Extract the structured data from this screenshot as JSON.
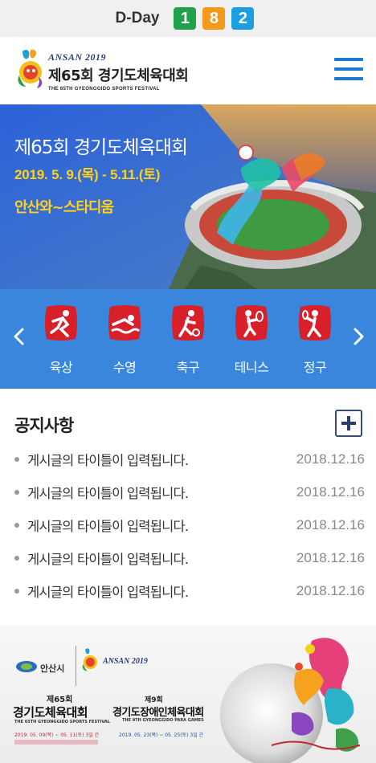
{
  "dday": {
    "label": "D-Day",
    "digits": [
      {
        "value": "1",
        "color": "#1fa34a"
      },
      {
        "value": "8",
        "color": "#f39a1a"
      },
      {
        "value": "2",
        "color": "#1a9fe0"
      }
    ]
  },
  "header": {
    "logo_ansan": "ANSAN 2019",
    "logo_main": "제65회 경기도체육대회",
    "logo_sub": "THE 65TH GYEONGGIDO SPORTS FESTIVAL"
  },
  "hero": {
    "title": "제65회 경기도체육대회",
    "date": "2019. 5. 9.(목) - 5.11.(토)",
    "venue": "안산와~스타디움"
  },
  "sports": {
    "items": [
      {
        "label": "육상",
        "icon": "athletics-icon"
      },
      {
        "label": "수영",
        "icon": "swimming-icon"
      },
      {
        "label": "축구",
        "icon": "soccer-icon"
      },
      {
        "label": "테니스",
        "icon": "tennis-icon"
      },
      {
        "label": "정구",
        "icon": "soft-tennis-icon"
      }
    ]
  },
  "notice": {
    "title": "공지사항",
    "rows": [
      {
        "title": "게시글의 타이틀이 입력됩니다.",
        "date": "2018.12.16"
      },
      {
        "title": "게시글의 타이틀이 입력됩니다.",
        "date": "2018.12.16"
      },
      {
        "title": "게시글의 타이틀이 입력됩니다.",
        "date": "2018.12.16"
      },
      {
        "title": "게시글의 타이틀이 입력됩니다.",
        "date": "2018.12.16"
      },
      {
        "title": "게시글의 타이틀이 입력됩니다.",
        "date": "2018.12.16"
      }
    ]
  },
  "banner": {
    "city": "안산시",
    "ansan": "ANSAN 2019",
    "left_edition": "제65회",
    "left_title": "경기도체육대회",
    "left_sub": "THE 65TH GYEONGGIDO SPORTS FESTIVAL",
    "left_date": "2019. 05. 09(목) ~ 05. 11(토) 3일 간",
    "right_edition": "제9회",
    "right_title": "경기도장애인체육대회",
    "right_sub": "THE 9TH GYEONGGIDO PARA GAMES",
    "right_date": "2019. 05. 23(목) ~ 05. 25(토) 3일 간"
  }
}
